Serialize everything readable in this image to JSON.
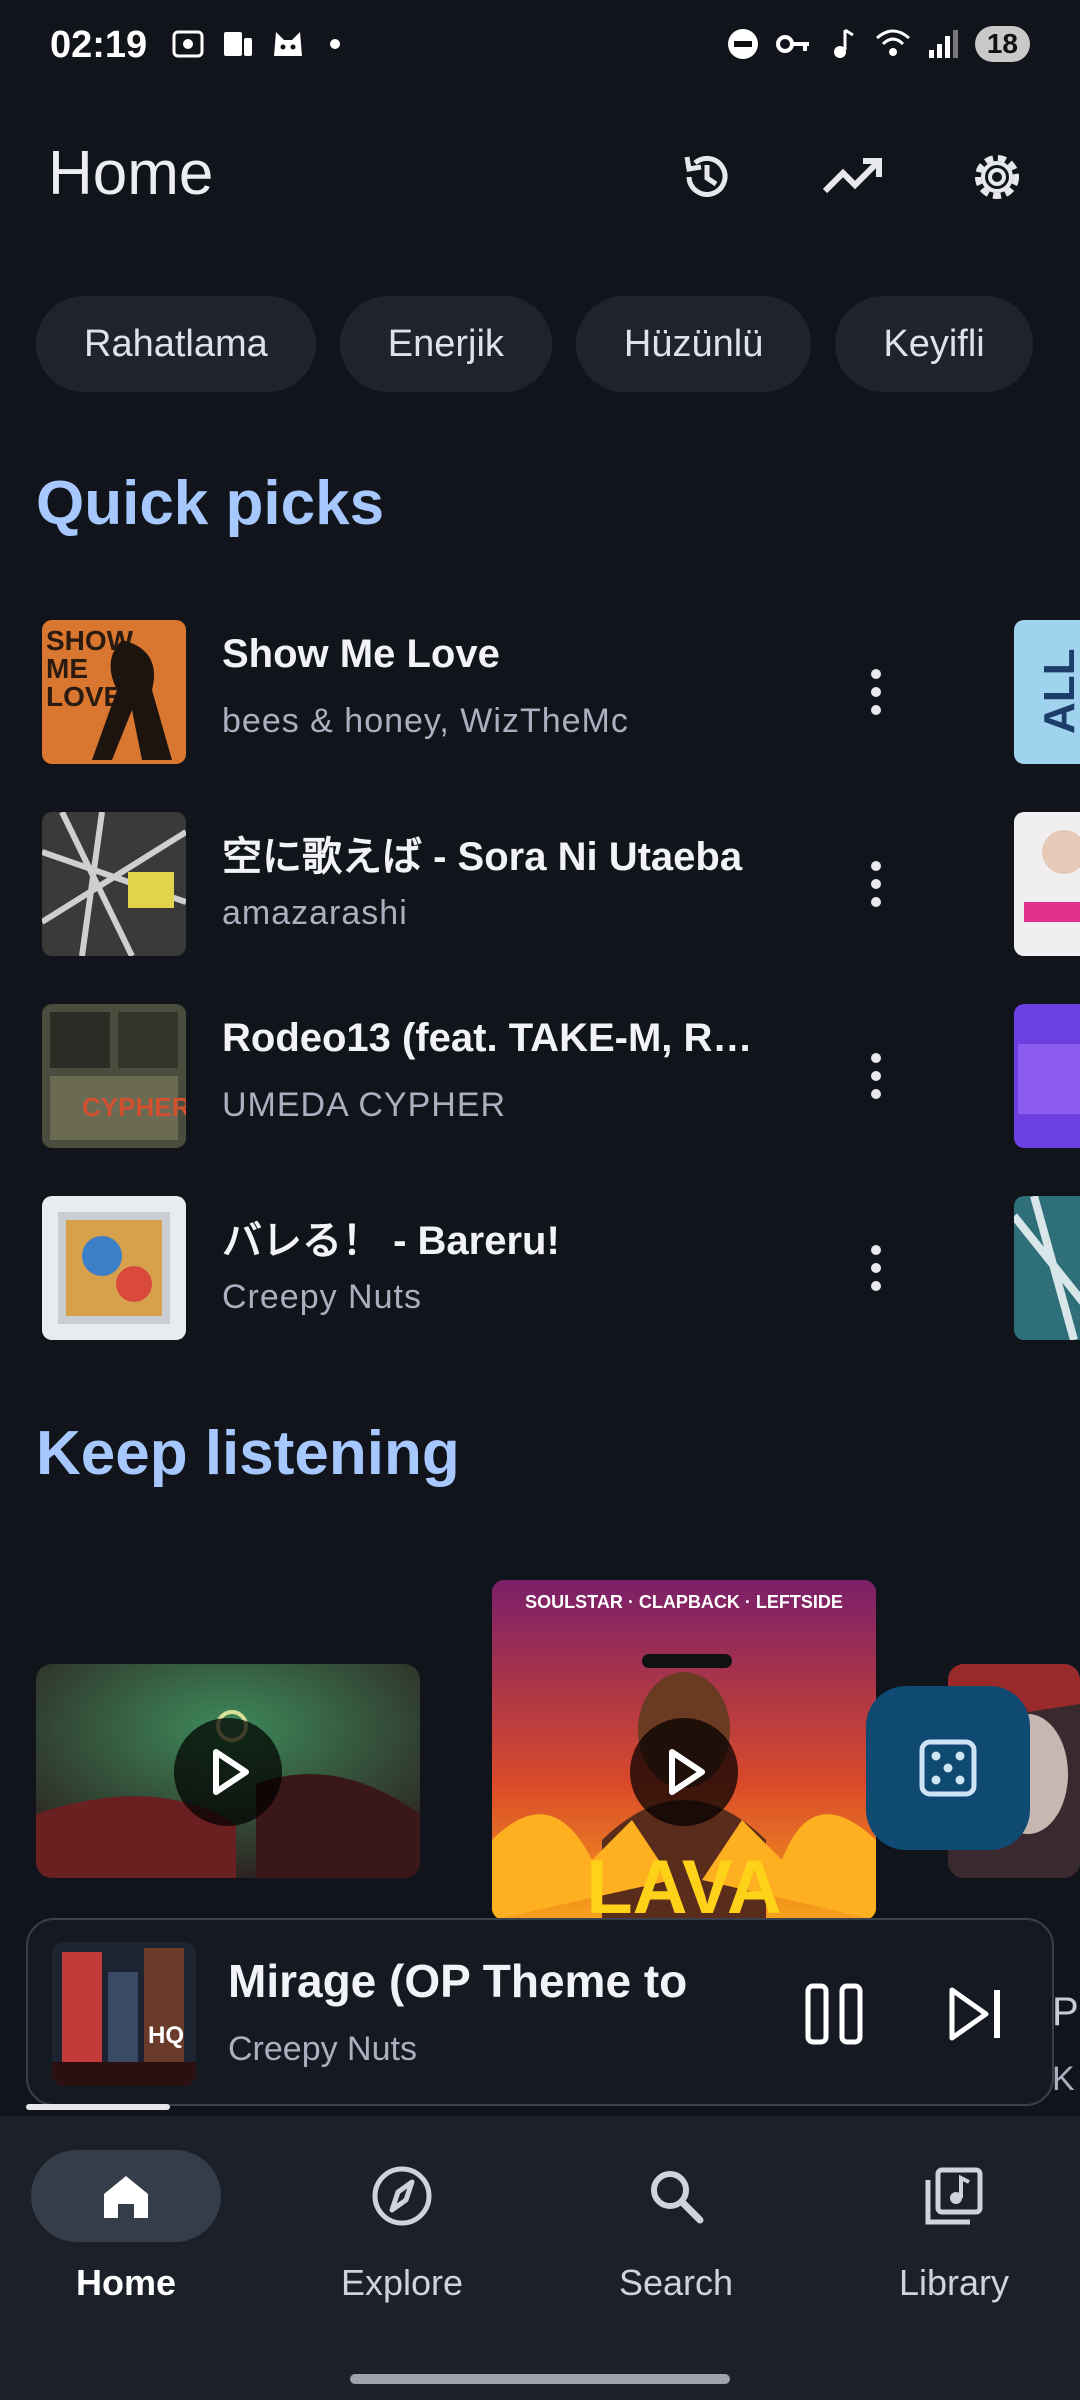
{
  "status_bar": {
    "time": "02:19",
    "battery": "18"
  },
  "header": {
    "title": "Home"
  },
  "chips": [
    "Rahatlama",
    "Enerjik",
    "Hüzünlü",
    "Keyifli"
  ],
  "quick_picks": {
    "title": "Quick picks",
    "items": [
      {
        "title": "Show Me Love",
        "artist": "bees & honey, WizTheMc"
      },
      {
        "title": "空に歌えば - Sora Ni Utaeba",
        "artist": "amazarashi"
      },
      {
        "title": "Rodeo13 (feat. TAKE-M, R…",
        "artist": "UMEDA CYPHER"
      },
      {
        "title": "バレる！ - Bareru!",
        "artist": "Creepy Nuts"
      }
    ]
  },
  "keep_listening": {
    "title": "Keep listening",
    "card2_banner": "SOULSTAR · CLAPBACK · LEFTSIDE",
    "card2_word": "LAVA"
  },
  "mini_player": {
    "title": "Mirage (OP Theme to",
    "artist": "Creepy Nuts",
    "badge": "HQ",
    "progress": 0.14
  },
  "peek": {
    "line1": "P",
    "line2": "K"
  },
  "nav": {
    "items": [
      {
        "label": "Home",
        "icon": "home-icon",
        "active": true
      },
      {
        "label": "Explore",
        "icon": "compass-icon",
        "active": false
      },
      {
        "label": "Search",
        "icon": "search-icon",
        "active": false
      },
      {
        "label": "Library",
        "icon": "library-icon",
        "active": false
      }
    ]
  },
  "colors": {
    "background": "#11141a",
    "accent": "#a6c8ff",
    "fab": "#0f4a73",
    "nav": "#1c2028"
  }
}
